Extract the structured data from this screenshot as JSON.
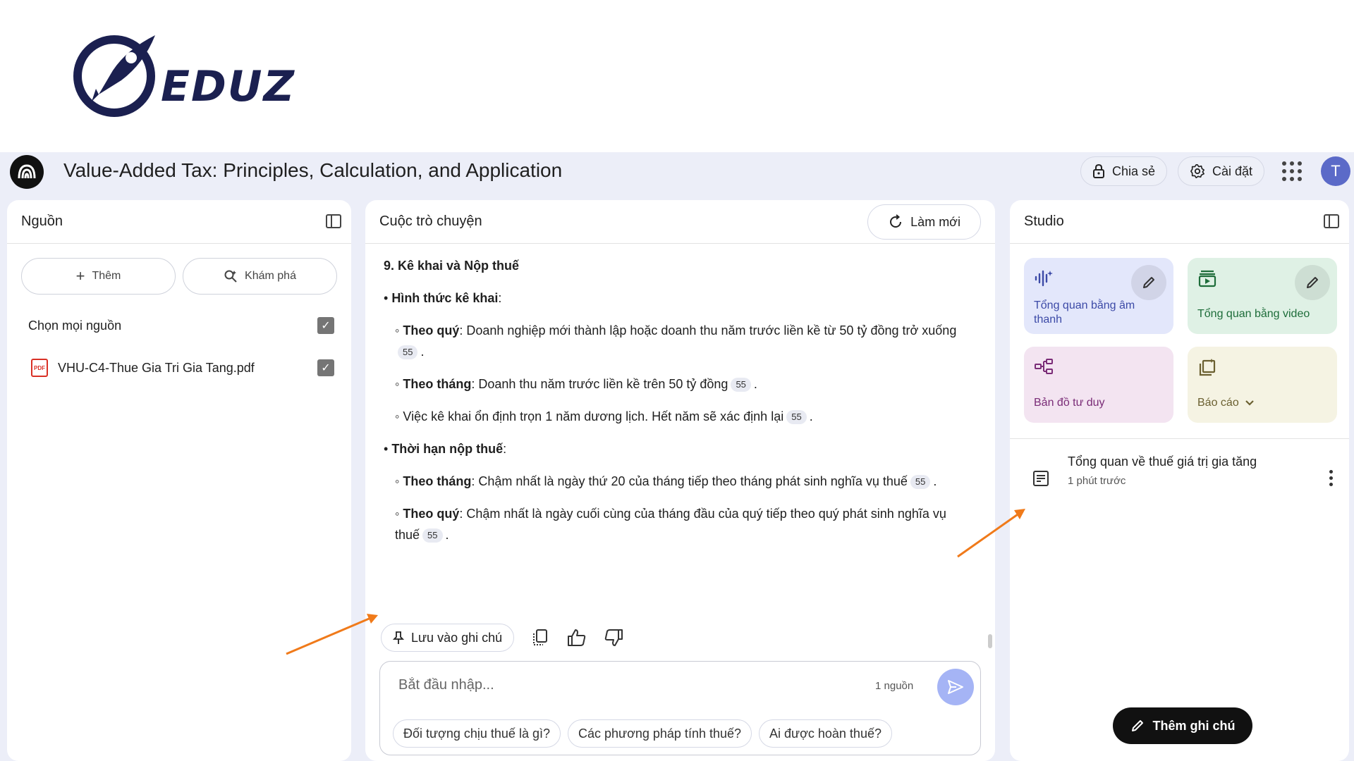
{
  "logo": {
    "text": "EDUZ"
  },
  "notebook": {
    "title": "Value-Added Tax: Principles, Calculation, and Application"
  },
  "header": {
    "share_label": "Chia sẻ",
    "settings_label": "Cài đặt",
    "avatar_initial": "T"
  },
  "sources": {
    "title": "Nguồn",
    "add_label": "Thêm",
    "discover_label": "Khám phá",
    "select_all_label": "Chọn mọi nguồn",
    "pdf_icon_text": "PDF",
    "items": [
      {
        "name": "VHU-C4-Thue Gia Tri Gia Tang.pdf",
        "checked": true
      }
    ]
  },
  "chat": {
    "title": "Cuộc trò chuyện",
    "refresh_label": "Làm mới",
    "heading": "9. Kê khai và Nộp thuế",
    "section1_title": "Hình thức kê khai",
    "s1_item1_term": "Theo quý",
    "s1_item1_text": ": Doanh nghiệp mới thành lập hoặc doanh thu năm trước liền kề từ 50 tỷ đồng trở xuống",
    "s1_item2_term": "Theo tháng",
    "s1_item2_text": ": Doanh thu năm trước liền kề trên 50 tỷ đồng",
    "s1_item3_text": "Việc kê khai ổn định trọn 1 năm dương lịch. Hết năm sẽ xác định lại",
    "section2_title": "Thời hạn nộp thuế",
    "s2_item1_term": "Theo tháng",
    "s2_item1_text": ": Chậm nhất là ngày thứ 20 của tháng tiếp theo tháng phát sinh nghĩa vụ thuế",
    "s2_item2_term": "Theo quý",
    "s2_item2_text": ": Chậm nhất là ngày cuối cùng của tháng đầu của quý tiếp theo quý phát sinh nghĩa vụ thuế",
    "citation": "55",
    "save_note_label": "Lưu vào ghi chú",
    "input_placeholder": "Bắt đầu nhập...",
    "source_count": "1 nguồn",
    "suggestions": [
      "Đối tượng chịu thuế là gì?",
      "Các phương pháp tính thuế?",
      "Ai được hoàn thuế?"
    ]
  },
  "studio": {
    "title": "Studio",
    "tiles": {
      "audio": "Tổng quan bằng âm thanh",
      "video": "Tổng quan bằng video",
      "mindmap": "Bản đồ tư duy",
      "report": "Báo cáo"
    },
    "note": {
      "title": "Tổng quan về thuế giá trị gia tăng",
      "time": "1 phút trước"
    },
    "add_note_label": "Thêm ghi chú"
  },
  "colors": {
    "accent_arrow": "#f07a1a",
    "brand_navy": "#1b2050",
    "send_button": "#a5b4f5"
  }
}
